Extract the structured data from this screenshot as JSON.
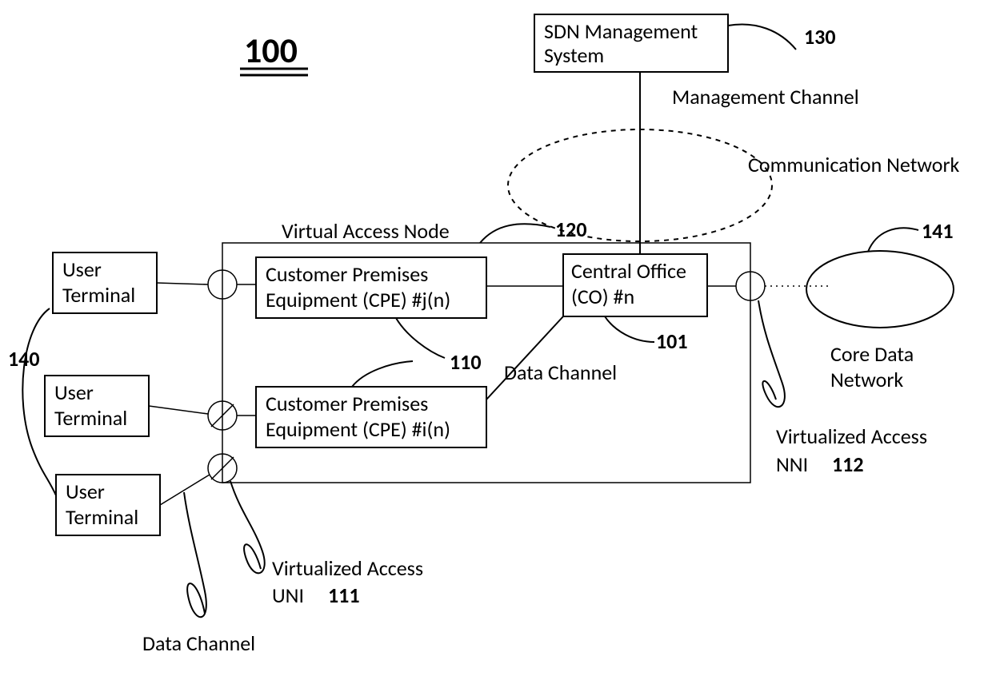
{
  "title": "100",
  "refs": {
    "sdn": "130",
    "van": "120",
    "cpe": "110",
    "co": "101",
    "uni": "111",
    "nni": "112",
    "user": "140",
    "core": "141"
  },
  "boxes": {
    "sdn_l1": "SDN Management",
    "sdn_l2": "System",
    "user_l1": "User",
    "user_l2": "Terminal",
    "cpe_j_l1": "Customer Premises",
    "cpe_j_l2": "Equipment (CPE) #j(n)",
    "cpe_i_l1": "Customer Premises",
    "cpe_i_l2": "Equipment (CPE) #i(n)",
    "co_l1": "Central Office",
    "co_l2": "(CO) #n"
  },
  "labels": {
    "van": "Virtual Access Node",
    "mgmt": "Management Channel",
    "comm": "Communication Network",
    "datachan": "Data Channel",
    "vuni_l1": "Virtualized Access",
    "vuni_l2": "UNI",
    "vnni_l1": "Virtualized Access",
    "vnni_l2": "NNI",
    "core_l1": "Core Data",
    "core_l2": "Network"
  }
}
